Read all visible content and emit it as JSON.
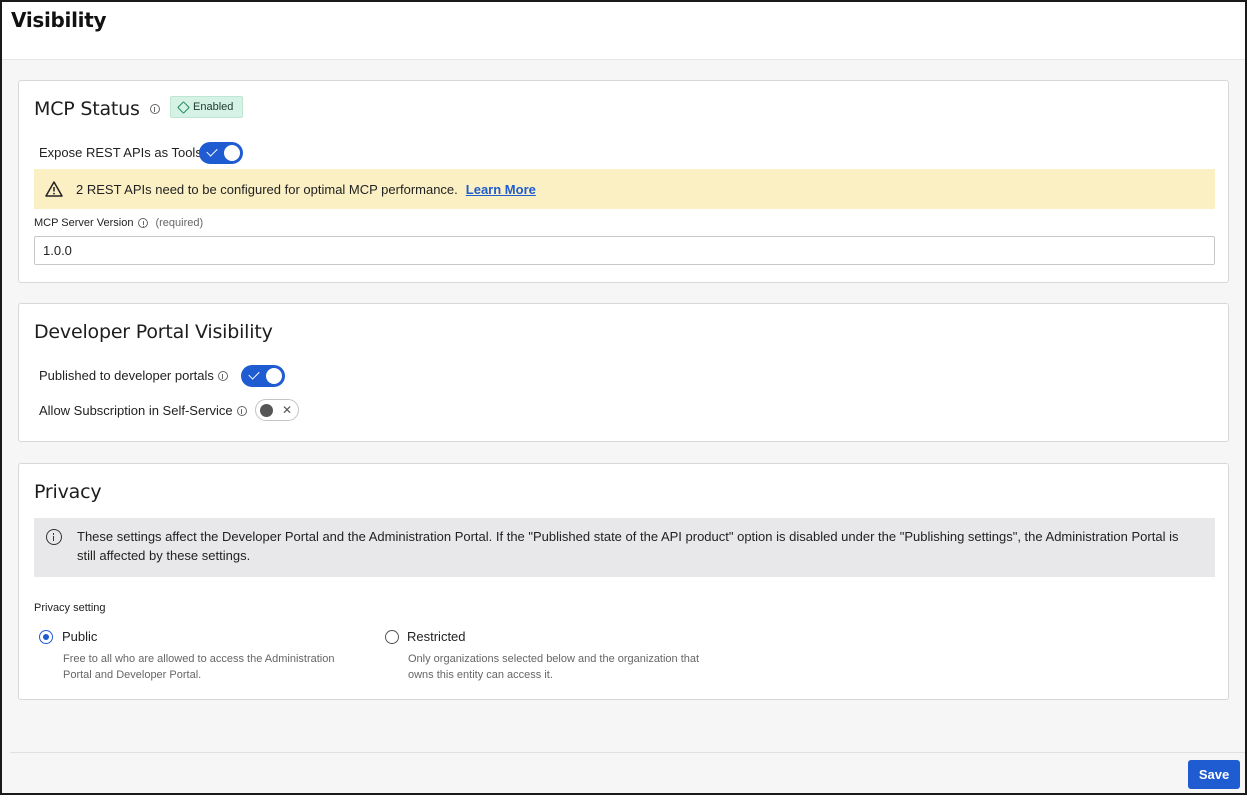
{
  "page": {
    "title": "Visibility"
  },
  "mcp_status": {
    "title": "MCP Status",
    "badge": "Enabled",
    "expose_label": "Expose REST APIs as Tools",
    "expose_on": true,
    "warning": {
      "text": "2 REST APIs need to be configured for optimal MCP performance.",
      "link": "Learn More"
    },
    "version": {
      "label": "MCP Server Version",
      "required": "(required)",
      "value": "1.0.0"
    }
  },
  "portal_visibility": {
    "title": "Developer Portal Visibility",
    "published_label": "Published to developer portals",
    "published_on": true,
    "subscription_label": "Allow Subscription in Self-Service",
    "subscription_on": false
  },
  "privacy": {
    "title": "Privacy",
    "info": "These settings affect the Developer Portal and the Administration Portal. If the \"Published state of the API product\" option is disabled under the \"Publishing settings\", the Administration Portal is still affected by these settings.",
    "setting_label": "Privacy setting",
    "options": [
      {
        "label": "Public",
        "description": "Free to all who are allowed to access the Administration Portal and Developer Portal.",
        "selected": true
      },
      {
        "label": "Restricted",
        "description": "Only organizations selected below and the organization that owns this entity can access it.",
        "selected": false
      }
    ]
  },
  "footer": {
    "save_label": "Save"
  },
  "colors": {
    "accent": "#1f5bd1",
    "badge_bg": "#d6f1e5",
    "warning_bg": "#fbf0c4",
    "info_bg": "#e8e8ea"
  }
}
